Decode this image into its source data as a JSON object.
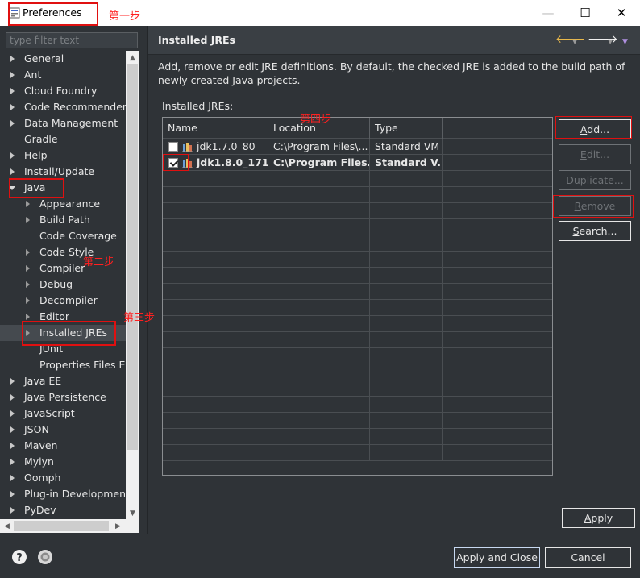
{
  "window": {
    "title": "Preferences",
    "controls": {
      "minimize": "—",
      "maximize": "☐",
      "close": "✕"
    }
  },
  "sidebar": {
    "filter_placeholder": "type filter text",
    "items": [
      {
        "label": "General",
        "arrow": "right",
        "level": 0
      },
      {
        "label": "Ant",
        "arrow": "right",
        "level": 0
      },
      {
        "label": "Cloud Foundry",
        "arrow": "right",
        "level": 0
      },
      {
        "label": "Code Recommenders",
        "arrow": "right",
        "level": 0
      },
      {
        "label": "Data Management",
        "arrow": "right",
        "level": 0
      },
      {
        "label": "Gradle",
        "arrow": "none",
        "level": 0
      },
      {
        "label": "Help",
        "arrow": "right",
        "level": 0
      },
      {
        "label": "Install/Update",
        "arrow": "right",
        "level": 0
      },
      {
        "label": "Java",
        "arrow": "down",
        "level": 0
      },
      {
        "label": "Appearance",
        "arrow": "right",
        "level": 1
      },
      {
        "label": "Build Path",
        "arrow": "right",
        "level": 1
      },
      {
        "label": "Code Coverage",
        "arrow": "none",
        "level": 1
      },
      {
        "label": "Code Style",
        "arrow": "right",
        "level": 1
      },
      {
        "label": "Compiler",
        "arrow": "right",
        "level": 1
      },
      {
        "label": "Debug",
        "arrow": "right",
        "level": 1
      },
      {
        "label": "Decompiler",
        "arrow": "right",
        "level": 1
      },
      {
        "label": "Editor",
        "arrow": "right",
        "level": 1
      },
      {
        "label": "Installed JREs",
        "arrow": "right",
        "level": 1,
        "selected": true
      },
      {
        "label": "JUnit",
        "arrow": "none",
        "level": 1
      },
      {
        "label": "Properties Files Editor",
        "arrow": "none",
        "level": 1
      },
      {
        "label": "Java EE",
        "arrow": "right",
        "level": 0
      },
      {
        "label": "Java Persistence",
        "arrow": "right",
        "level": 0
      },
      {
        "label": "JavaScript",
        "arrow": "right",
        "level": 0
      },
      {
        "label": "JSON",
        "arrow": "right",
        "level": 0
      },
      {
        "label": "Maven",
        "arrow": "right",
        "level": 0
      },
      {
        "label": "Mylyn",
        "arrow": "right",
        "level": 0
      },
      {
        "label": "Oomph",
        "arrow": "right",
        "level": 0
      },
      {
        "label": "Plug-in Development",
        "arrow": "right",
        "level": 0
      },
      {
        "label": "PyDev",
        "arrow": "right",
        "level": 0
      }
    ]
  },
  "page": {
    "title": "Installed JREs",
    "description": "Add, remove or edit JRE definitions. By default, the checked JRE is added to the build path of newly created Java projects.",
    "table_label": "Installed JREs:",
    "table": {
      "columns": [
        "Name",
        "Location",
        "Type"
      ],
      "rows": [
        {
          "name": "jdk1.7.0_80",
          "location": "C:\\Program Files\\...",
          "type": "Standard VM",
          "checked": false
        },
        {
          "name": "jdk1.8.0_171...",
          "location": "C:\\Program Files...",
          "type": "Standard V...",
          "checked": true
        }
      ]
    },
    "buttons": {
      "add": {
        "pre": "",
        "mn": "A",
        "post": "dd..."
      },
      "edit": {
        "pre": "",
        "mn": "E",
        "post": "dit..."
      },
      "duplicate": {
        "pre": "Dupli",
        "mn": "c",
        "post": "ate..."
      },
      "remove": {
        "pre": "",
        "mn": "R",
        "post": "emove"
      },
      "search": {
        "pre": "",
        "mn": "S",
        "post": "earch..."
      },
      "apply": {
        "pre": "",
        "mn": "A",
        "post": "pply"
      }
    }
  },
  "footer": {
    "apply_close": "Apply and Close",
    "cancel": "Cancel"
  },
  "annotations": {
    "step1": "第一步",
    "step2": "第二步",
    "step3": "第三步",
    "step4": "第四步"
  },
  "colors": {
    "background": "#2f3337",
    "annotation_red": "#e01010",
    "text": "#e6e6e6"
  }
}
